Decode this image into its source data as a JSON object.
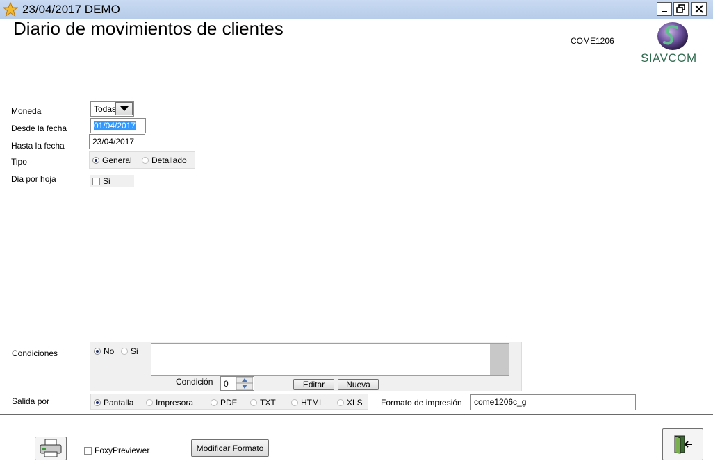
{
  "window": {
    "title": "23/04/2017  DEMO"
  },
  "header": {
    "heading": "Diario de movimientos de clientes",
    "code": "COME1206",
    "logo_text": "SIAVCOM"
  },
  "form": {
    "moneda": {
      "label": "Moneda",
      "value": "Todas"
    },
    "desde": {
      "label": "Desde la fecha",
      "value": "01/04/2017"
    },
    "hasta": {
      "label": "Hasta la fecha",
      "value": "23/04/2017"
    },
    "tipo": {
      "label": "Tipo",
      "options": [
        "General",
        "Detallado"
      ],
      "selected": "General"
    },
    "dia_por_hoja": {
      "label": "Dia por hoja",
      "checkbox_label": "Si",
      "checked": false
    },
    "condiciones": {
      "label": "Condiciones",
      "options": [
        "No",
        "Si"
      ],
      "selected": "No",
      "condicion_label": "Condición",
      "condicion_value": "0",
      "editar_label": "Editar",
      "nueva_label": "Nueva"
    },
    "salida": {
      "label": "Salida por",
      "options": [
        "Pantalla",
        "Impresora",
        "PDF",
        "TXT",
        "HTML",
        "XLS"
      ],
      "selected": "Pantalla"
    },
    "formato": {
      "label": "Formato de impresión",
      "value": "come1206c_g"
    }
  },
  "footer": {
    "foxy_label": "FoxyPreviewer",
    "foxy_checked": false,
    "modificar_label": "Modificar Formato"
  },
  "icons": {
    "app": "star-icon",
    "print": "printer-icon",
    "exit": "exit-door-icon"
  },
  "colors": {
    "titlebar": "#c1d5ef",
    "selection": "#3399ff",
    "logo_green": "#2e6b4f"
  }
}
